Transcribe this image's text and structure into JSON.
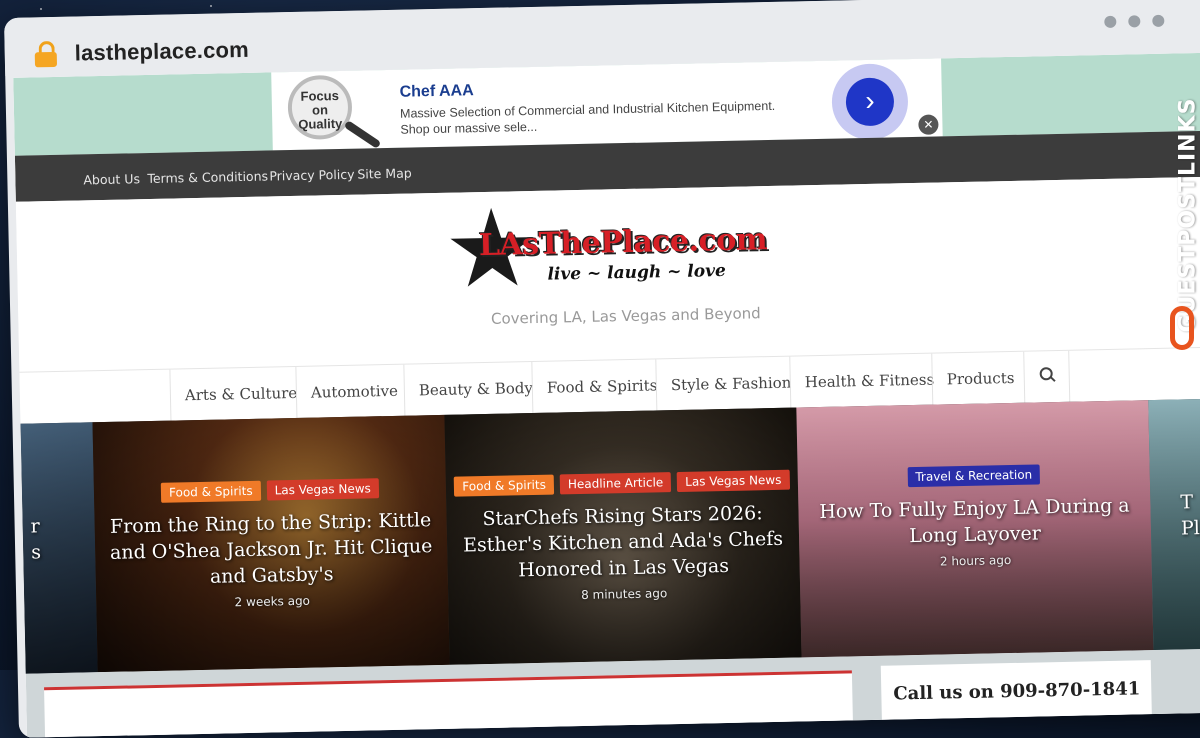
{
  "browser": {
    "url": "lastheplace.com"
  },
  "ad": {
    "image_text": "Focus on Quality",
    "title": "Chef AAA",
    "description": "Massive Selection of Commercial and Industrial Kitchen Equipment. Shop our massive sele...",
    "go_icon": "chevron-right-icon",
    "close_icon": "close-icon",
    "close_glyph": "✕",
    "go_glyph": "›"
  },
  "top_nav": {
    "items": [
      "About Us",
      "Terms & Conditions",
      "Privacy Policy",
      "Site Map"
    ]
  },
  "logo": {
    "wordmark": "LAsThePlace.com",
    "tagline": "live ~ laugh ~ love",
    "subtitle": "Covering LA, Las Vegas and Beyond"
  },
  "main_nav": {
    "items": [
      "Arts & Culture",
      "Automotive",
      "Beauty & Body",
      "Food & Spirits",
      "Style & Fashion",
      "Health & Fitness",
      "Products"
    ],
    "search_icon": "search-icon"
  },
  "slides": [
    {
      "partial_title": "r\ns"
    },
    {
      "badges": [
        "Food & Spirits",
        "Las Vegas News"
      ],
      "title": "From the Ring to the Strip: Kittle and O'Shea Jackson Jr. Hit Clique and Gatsby's",
      "time": "2 weeks ago"
    },
    {
      "badges": [
        "Food & Spirits",
        "Headline Article",
        "Las Vegas News"
      ],
      "title": "StarChefs Rising Stars 2026: Esther's Kitchen and Ada's Chefs Honored in Las Vegas",
      "time": "8 minutes ago"
    },
    {
      "badges": [
        "Travel & Recreation"
      ],
      "title": "How To Fully Enjoy LA During a Long Layover",
      "time": "2 hours ago"
    },
    {
      "partial_title": "T\nPla"
    }
  ],
  "sidebar": {
    "call_text": "Call us on 909-870-1841"
  },
  "watermark": {
    "text": "GUESTPOSTLINKS"
  },
  "colors": {
    "accent_orange": "#f07a28",
    "accent_red": "#d33b2a",
    "accent_blue": "#2a2ea8",
    "nav_dark": "#3c3c3c",
    "logo_red": "#d71f26"
  }
}
